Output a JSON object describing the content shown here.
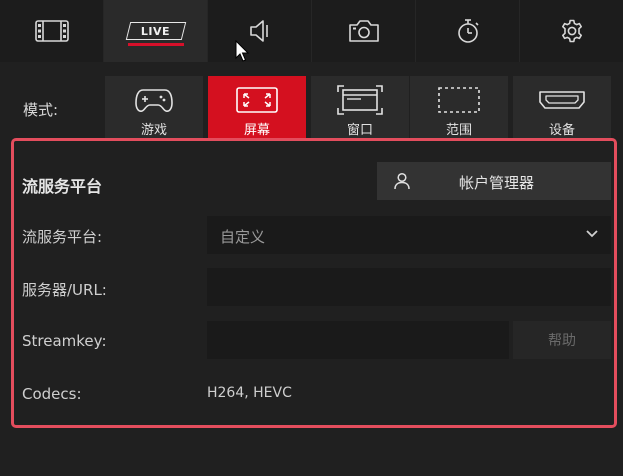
{
  "top_tabs": [
    {
      "id": "video",
      "icon": "film-icon"
    },
    {
      "id": "live",
      "icon": "live-badge",
      "label": "LIVE"
    },
    {
      "id": "audio",
      "icon": "speaker-icon"
    },
    {
      "id": "camera",
      "icon": "camera-icon"
    },
    {
      "id": "timer",
      "icon": "stopwatch-icon"
    },
    {
      "id": "settings",
      "icon": "gear-icon"
    }
  ],
  "active_tab": "live",
  "mode": {
    "label": "模式:",
    "options": [
      {
        "label": "游戏",
        "icon": "gamepad-icon"
      },
      {
        "label": "屏幕",
        "icon": "screen-expand-icon"
      },
      {
        "label": "窗口",
        "icon": "window-icon"
      },
      {
        "label": "范围",
        "icon": "region-icon"
      },
      {
        "label": "设备",
        "icon": "hdmi-icon"
      }
    ],
    "selected": "屏幕"
  },
  "streaming": {
    "section_title": "流服务平台",
    "account_manager_label": "帐户管理器",
    "platform_label": "流服务平台:",
    "platform_value": "自定义",
    "server_label": "服务器/URL:",
    "server_value": "",
    "streamkey_label": "Streamkey:",
    "streamkey_value": "",
    "help_label": "帮助",
    "codecs_label": "Codecs:",
    "codecs_value": "H264, HEVC"
  },
  "colors": {
    "accent": "#d4101f",
    "highlight_border": "#e34d5d",
    "background": "#202020"
  }
}
